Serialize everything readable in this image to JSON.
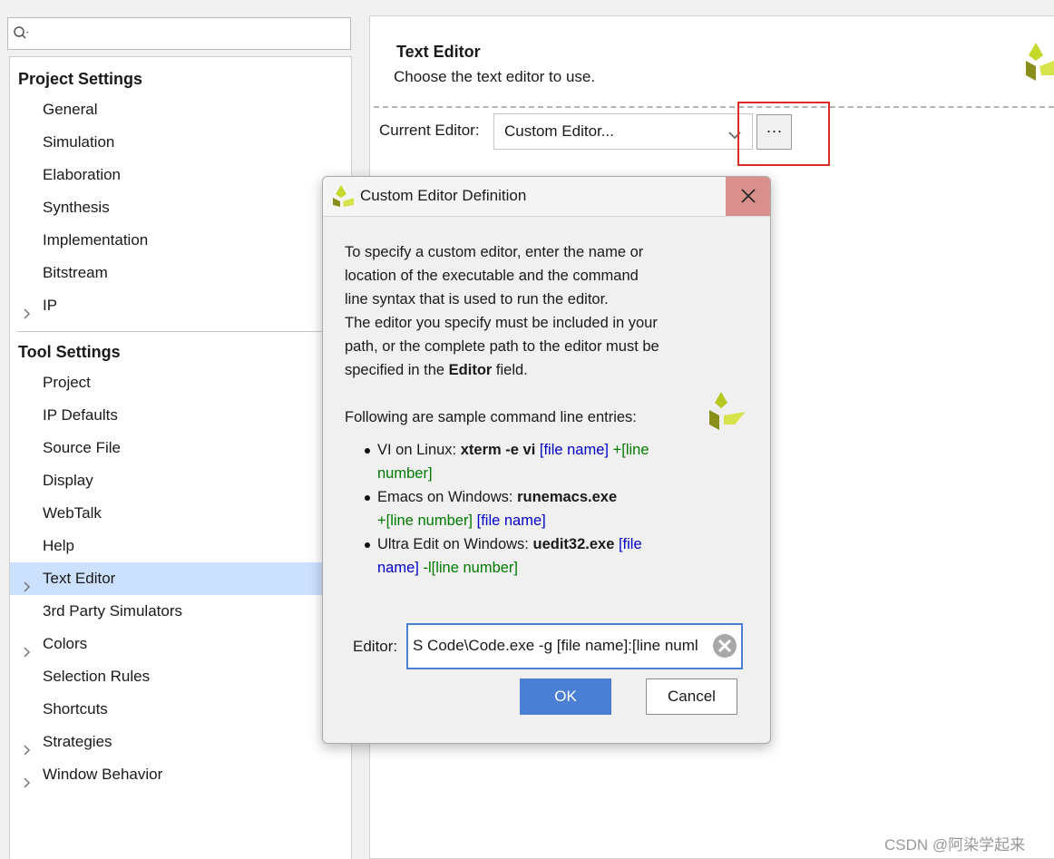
{
  "search": {
    "value": ""
  },
  "sidebar": {
    "groups": [
      {
        "title": "Project Settings",
        "items": [
          {
            "label": "General"
          },
          {
            "label": "Simulation"
          },
          {
            "label": "Elaboration"
          },
          {
            "label": "Synthesis"
          },
          {
            "label": "Implementation"
          },
          {
            "label": "Bitstream"
          },
          {
            "label": "IP",
            "expandable": true
          }
        ]
      },
      {
        "title": "Tool Settings",
        "items": [
          {
            "label": "Project"
          },
          {
            "label": "IP Defaults"
          },
          {
            "label": "Source File"
          },
          {
            "label": "Display"
          },
          {
            "label": "WebTalk"
          },
          {
            "label": "Help"
          },
          {
            "label": "Text Editor",
            "expandable": true,
            "selected": true
          },
          {
            "label": "3rd Party Simulators"
          },
          {
            "label": "Colors",
            "expandable": true
          },
          {
            "label": "Selection Rules"
          },
          {
            "label": "Shortcuts"
          },
          {
            "label": "Strategies",
            "expandable": true
          },
          {
            "label": "Window Behavior",
            "expandable": true
          }
        ]
      }
    ]
  },
  "main": {
    "title": "Text Editor",
    "description": "Choose the text editor to use.",
    "current_editor_label": "Current Editor:",
    "current_editor_value": "Custom Editor...",
    "browse_label": "···"
  },
  "dialog": {
    "title": "Custom Editor Definition",
    "intro_lines": [
      "To specify a custom editor, enter the name or",
      "location of the executable and the command",
      "line syntax that is used to run the editor.",
      "The editor you specify must be included in your",
      "path, or the complete path to the editor must be"
    ],
    "intro_last_prefix": "specified in the ",
    "intro_last_bold": "Editor",
    "intro_last_suffix": " field.",
    "samples_heading": "Following are sample command line entries:",
    "samples": [
      {
        "prefix": "VI on Linux: ",
        "command": "xterm -e vi",
        "arg1": "[file name]",
        "arg2a": "+[line",
        "arg2b": "number]"
      },
      {
        "prefix": "Emacs on Windows: ",
        "command": "runemacs.exe",
        "arg1": "+[line number]",
        "arg2": "[file name]"
      },
      {
        "prefix": "Ultra Edit on Windows: ",
        "command": "uedit32.exe",
        "arg1a": "[file",
        "arg1b": "name]",
        "arg2": "-l[line number]"
      }
    ],
    "editor_label": "Editor:",
    "editor_value": "S Code\\Code.exe -g [file name]:[line numl",
    "ok_label": "OK",
    "cancel_label": "Cancel"
  },
  "watermark": "CSDN @阿染学起来",
  "colors": {
    "accent": "#4a7fd4",
    "selection": "#cce0ff",
    "close_hover": "#d9908c",
    "highlight": "#e02a2a",
    "link_blue": "#0000cc",
    "link_green": "#007a00"
  }
}
